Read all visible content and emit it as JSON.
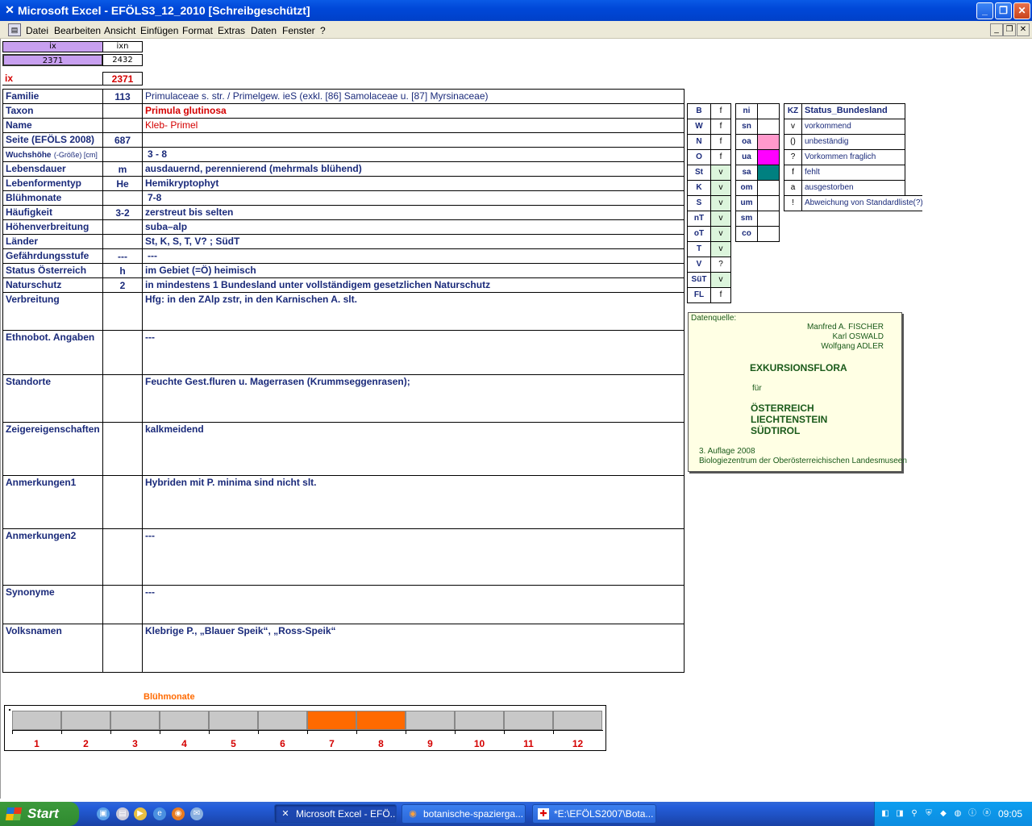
{
  "window": {
    "title": "Microsoft Excel - EFÖLS3_12_2010  [Schreibgeschützt]",
    "app_icon": "excel-icon"
  },
  "menu": [
    "Datei",
    "Bearbeiten",
    "Ansicht",
    "Einfügen",
    "Format",
    "Extras",
    "Daten",
    "Fenster",
    "?"
  ],
  "index": {
    "ix_head": "ix",
    "ixn_head": "ixn",
    "ix_val": "2371",
    "ixn_val": "2432",
    "ix_label": "ix",
    "ix_value": "2371"
  },
  "rows": [
    {
      "label": "Familie",
      "code": "113",
      "value": "Primulaceae s. str.  /  Primelgew. ieS (exkl. [86] Samolaceae u. [87] Myrsinaceae)"
    },
    {
      "label": "Taxon",
      "code": "",
      "value": "Primula glutinosa"
    },
    {
      "label": "Name",
      "code": "",
      "value": "Kleb- Primel"
    },
    {
      "label": "Seite (EFÖLS 2008)",
      "code": "687",
      "value": ""
    },
    {
      "label": "Wuchshöhe",
      "label_sub": "(-Größe) [cm]",
      "code": "",
      "value": "3 - 8"
    },
    {
      "label": "Lebensdauer",
      "code": "m",
      "value": "ausdauernd, perennierend (mehrmals blühend)"
    },
    {
      "label": "Lebenformentyp",
      "code": "He",
      "value": "Hemikryptophyt"
    },
    {
      "label": "Blühmonate",
      "code": "",
      "value": "7-8"
    },
    {
      "label": "Häufigkeit",
      "code": "3-2",
      "value": "zerstreut bis selten"
    },
    {
      "label": "Höhenverbreitung",
      "code": "",
      "value": "suba–alp"
    },
    {
      "label": "Länder",
      "code": "",
      "value": "St, K, S, T, V? ; SüdT"
    },
    {
      "label": "Gefährdungsstufe",
      "code": "---",
      "value": "---"
    },
    {
      "label": "Status Österreich",
      "code": "h",
      "value": "im Gebiet (=Ö) heimisch"
    },
    {
      "label": "Naturschutz",
      "code": "2",
      "value": "in mindestens 1 Bundesland unter vollständigem gesetzlichen Naturschutz"
    },
    {
      "label": "Verbreitung",
      "code": "",
      "value": "Hfg:  in den ZAlp zstr, in den Karnischen A. slt."
    },
    {
      "label": "Ethnobot. Angaben",
      "code": "",
      "value": "---"
    },
    {
      "label": "Standorte",
      "code": "",
      "value": "Feuchte Gest.fluren u. Magerrasen (Krummseggenrasen);"
    },
    {
      "label": "Zeigereigenschaften",
      "code": "",
      "value": "kalkmeidend"
    },
    {
      "label": "Anmerkungen1",
      "code": "",
      "value": "Hybriden mit P. minima sind nicht slt."
    },
    {
      "label": "Anmerkungen2",
      "code": "",
      "value": "---"
    },
    {
      "label": "Synonyme",
      "code": "",
      "value": "---"
    },
    {
      "label": "Volksnamen",
      "code": "",
      "value": "Klebrige P., „Blauer Speik“, „Ross-Speik“"
    }
  ],
  "states": [
    {
      "code": "B",
      "val": "f"
    },
    {
      "code": "W",
      "val": "f"
    },
    {
      "code": "N",
      "val": "f"
    },
    {
      "code": "O",
      "val": "f"
    },
    {
      "code": "St",
      "val": "v"
    },
    {
      "code": "K",
      "val": "v"
    },
    {
      "code": "S",
      "val": "v"
    },
    {
      "code": "nT",
      "val": "v"
    },
    {
      "code": "oT",
      "val": "v"
    },
    {
      "code": "T",
      "val": "v"
    },
    {
      "code": "V",
      "val": "?"
    },
    {
      "code": "SüT",
      "val": "v"
    },
    {
      "code": "FL",
      "val": "f"
    }
  ],
  "zones": [
    {
      "code": "ni",
      "color": ""
    },
    {
      "code": "sn",
      "color": ""
    },
    {
      "code": "oa",
      "color": "#ff99cc"
    },
    {
      "code": "ua",
      "color": "#ff00ff"
    },
    {
      "code": "sa",
      "color": "#008080"
    },
    {
      "code": "om",
      "color": ""
    },
    {
      "code": "um",
      "color": ""
    },
    {
      "code": "sm",
      "color": ""
    },
    {
      "code": "co",
      "color": ""
    }
  ],
  "legend": {
    "kz": "KZ",
    "title": "Status_Bundesland",
    "items": [
      {
        "k": "v",
        "t": "vorkommend"
      },
      {
        "k": "()",
        "t": "unbeständig"
      },
      {
        "k": "?",
        "t": "Vorkommen fraglich"
      },
      {
        "k": "f",
        "t": "fehlt"
      },
      {
        "k": "a",
        "t": "ausgestorben"
      },
      {
        "k": "!",
        "t": "Abweichung von Standardliste(?)"
      }
    ]
  },
  "source": {
    "label": "Datenquelle:",
    "authors": [
      "Manfred A. FISCHER",
      "Karl OSWALD",
      "Wolfgang ADLER"
    ],
    "title": "EXKURSIONSFLORA",
    "fuer": "für",
    "countries": [
      "ÖSTERREICH",
      "LIECHTENSTEIN",
      "SÜDTIROL"
    ],
    "edition": "3. Auflage 2008",
    "publisher": "Biologiezentrum der Oberösterreichischen Landesmuseen"
  },
  "bloom": {
    "title": "Blühmonate",
    "months": [
      "1",
      "2",
      "3",
      "4",
      "5",
      "6",
      "7",
      "8",
      "9",
      "10",
      "11",
      "12"
    ],
    "active": [
      false,
      false,
      false,
      false,
      false,
      false,
      true,
      true,
      false,
      false,
      false,
      false
    ],
    "active_color": "#ff6a00"
  },
  "taskbar": {
    "start": "Start",
    "tasks": [
      "Microsoft Excel - EFÖ...",
      "botanische-spazierga...",
      "*E:\\EFÖLS2007\\Bota..."
    ],
    "clock": "09:05"
  }
}
